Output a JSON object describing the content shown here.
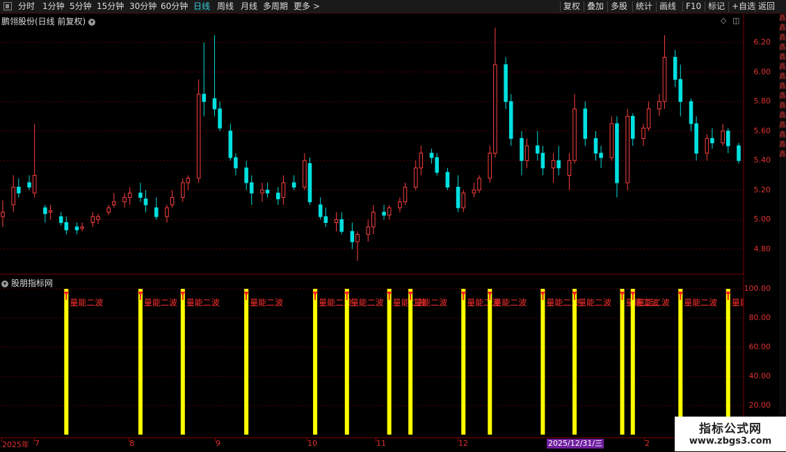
{
  "toolbar": {
    "left_items": [
      "分时",
      "1分钟",
      "5分钟",
      "15分钟",
      "30分钟",
      "60分钟",
      "日线",
      "周线",
      "月线",
      "多周期",
      "更多 >"
    ],
    "active_item": "日线",
    "right_items": [
      "复权",
      "叠加",
      "多股",
      "统计",
      "画线",
      "F10",
      "标记",
      "+自选",
      "返回"
    ]
  },
  "main_chart": {
    "title": "鹏翎股份(日线 前复权)",
    "y_labels": [
      "6.20",
      "6.00",
      "5.80",
      "5.60",
      "5.40",
      "5.20",
      "5.00",
      "4.80"
    ]
  },
  "indicator": {
    "title": "股朋指标网",
    "signal_label": "量能二波",
    "y_labels": [
      "100.00",
      "80.00",
      "60.00",
      "40.00",
      "20.00"
    ]
  },
  "x_axis": {
    "labels": [
      "2025年",
      "7",
      "8",
      "9",
      "10",
      "11",
      "12",
      "2"
    ],
    "cursor_date": "2025/12/31/三"
  },
  "side_strip_text": "鑫鑫鑫鑫鑫鑫鑫鑫鑫鑫鑫鑫鑫鑫鑫",
  "watermark": {
    "title": "指标公式网",
    "url": "www.zbgs3.com"
  },
  "colors": {
    "up": "#ff4040",
    "down": "#00e0e0",
    "signal_bar": "#ffff00",
    "grid": "#5a0000",
    "active": "#39d0e0"
  },
  "chart_data": {
    "type": "candlestick",
    "price_range": [
      4.7,
      6.3
    ],
    "indicator_range": [
      0,
      100
    ],
    "candles": [
      [
        5.02,
        5.13,
        4.95,
        5.05
      ],
      [
        5.1,
        5.3,
        5.05,
        5.22
      ],
      [
        5.22,
        5.28,
        5.15,
        5.18
      ],
      [
        5.25,
        5.3,
        5.2,
        5.22
      ],
      [
        5.18,
        5.65,
        5.15,
        5.3
      ],
      [
        5.08,
        5.1,
        4.98,
        5.04
      ],
      [
        5.05,
        5.1,
        5.0,
        5.06
      ],
      [
        5.02,
        5.05,
        4.96,
        4.98
      ],
      [
        4.98,
        5.02,
        4.9,
        4.93
      ],
      [
        4.95,
        4.98,
        4.9,
        4.93
      ],
      [
        4.94,
        4.98,
        4.92,
        4.95
      ],
      [
        4.98,
        5.05,
        4.95,
        5.02
      ],
      [
        5.0,
        5.04,
        4.97,
        5.02
      ],
      [
        5.05,
        5.1,
        5.03,
        5.08
      ],
      [
        5.1,
        5.18,
        5.08,
        5.12
      ],
      [
        5.12,
        5.18,
        5.08,
        5.15
      ],
      [
        5.15,
        5.22,
        5.1,
        5.18
      ],
      [
        5.18,
        5.25,
        5.12,
        5.15
      ],
      [
        5.14,
        5.2,
        5.05,
        5.1
      ],
      [
        5.08,
        5.15,
        5.0,
        5.02
      ],
      [
        5.02,
        5.1,
        4.98,
        5.08
      ],
      [
        5.1,
        5.2,
        5.08,
        5.15
      ],
      [
        5.15,
        5.28,
        5.12,
        5.25
      ],
      [
        5.25,
        5.3,
        5.2,
        5.28
      ],
      [
        5.28,
        5.95,
        5.25,
        5.85
      ],
      [
        5.85,
        6.2,
        5.7,
        5.8
      ],
      [
        5.82,
        6.25,
        5.7,
        5.75
      ],
      [
        5.75,
        5.8,
        5.6,
        5.62
      ],
      [
        5.6,
        5.65,
        5.4,
        5.42
      ],
      [
        5.42,
        5.45,
        5.3,
        5.35
      ],
      [
        5.35,
        5.4,
        5.2,
        5.25
      ],
      [
        5.25,
        5.3,
        5.1,
        5.18
      ],
      [
        5.18,
        5.25,
        5.12,
        5.2
      ],
      [
        5.2,
        5.25,
        5.15,
        5.18
      ],
      [
        5.18,
        5.22,
        5.1,
        5.14
      ],
      [
        5.15,
        5.3,
        5.1,
        5.25
      ],
      [
        5.25,
        5.3,
        5.2,
        5.22
      ],
      [
        5.22,
        5.45,
        5.2,
        5.4
      ],
      [
        5.38,
        5.42,
        5.1,
        5.12
      ],
      [
        5.1,
        5.15,
        5.0,
        5.02
      ],
      [
        5.02,
        5.08,
        4.95,
        4.98
      ],
      [
        4.98,
        5.05,
        4.92,
        5.0
      ],
      [
        5.0,
        5.05,
        4.9,
        4.92
      ],
      [
        4.92,
        4.98,
        4.8,
        4.85
      ],
      [
        4.85,
        4.92,
        4.72,
        4.9
      ],
      [
        4.9,
        5.0,
        4.85,
        4.95
      ],
      [
        4.95,
        5.1,
        4.9,
        5.05
      ],
      [
        5.05,
        5.1,
        5.0,
        5.03
      ],
      [
        5.03,
        5.1,
        5.0,
        5.08
      ],
      [
        5.08,
        5.15,
        5.05,
        5.12
      ],
      [
        5.12,
        5.25,
        5.1,
        5.22
      ],
      [
        5.22,
        5.4,
        5.2,
        5.35
      ],
      [
        5.35,
        5.5,
        5.3,
        5.45
      ],
      [
        5.45,
        5.48,
        5.38,
        5.42
      ],
      [
        5.42,
        5.45,
        5.3,
        5.32
      ],
      [
        5.32,
        5.35,
        5.2,
        5.22
      ],
      [
        5.22,
        5.3,
        5.05,
        5.08
      ],
      [
        5.08,
        5.2,
        5.05,
        5.18
      ],
      [
        5.18,
        5.25,
        5.15,
        5.2
      ],
      [
        5.2,
        5.3,
        5.18,
        5.28
      ],
      [
        5.28,
        5.5,
        5.25,
        5.45
      ],
      [
        5.45,
        6.3,
        5.42,
        6.05
      ],
      [
        6.05,
        6.1,
        5.75,
        5.8
      ],
      [
        5.8,
        5.85,
        5.5,
        5.55
      ],
      [
        5.55,
        5.6,
        5.3,
        5.4
      ],
      [
        5.4,
        5.55,
        5.35,
        5.5
      ],
      [
        5.5,
        5.6,
        5.4,
        5.45
      ],
      [
        5.45,
        5.5,
        5.3,
        5.35
      ],
      [
        5.35,
        5.45,
        5.25,
        5.4
      ],
      [
        5.4,
        5.5,
        5.3,
        5.35
      ],
      [
        5.3,
        5.45,
        5.2,
        5.4
      ],
      [
        5.4,
        5.85,
        5.38,
        5.75
      ],
      [
        5.75,
        5.8,
        5.5,
        5.55
      ],
      [
        5.55,
        5.6,
        5.4,
        5.45
      ],
      [
        5.45,
        5.5,
        5.35,
        5.42
      ],
      [
        5.42,
        5.7,
        5.4,
        5.65
      ],
      [
        5.65,
        5.7,
        5.15,
        5.25
      ],
      [
        5.25,
        5.75,
        5.2,
        5.7
      ],
      [
        5.7,
        5.72,
        5.5,
        5.55
      ],
      [
        5.55,
        5.65,
        5.5,
        5.62
      ],
      [
        5.62,
        5.8,
        5.6,
        5.75
      ],
      [
        5.75,
        5.85,
        5.7,
        5.8
      ],
      [
        5.8,
        6.25,
        5.75,
        6.1
      ],
      [
        6.1,
        6.15,
        5.9,
        5.95
      ],
      [
        5.95,
        6.05,
        5.7,
        5.8
      ],
      [
        5.8,
        5.82,
        5.6,
        5.65
      ],
      [
        5.65,
        5.7,
        5.4,
        5.45
      ],
      [
        5.45,
        5.58,
        5.4,
        5.55
      ],
      [
        5.55,
        5.62,
        5.48,
        5.52
      ],
      [
        5.52,
        5.65,
        5.5,
        5.6
      ],
      [
        5.6,
        5.62,
        5.45,
        5.5
      ],
      [
        5.5,
        5.52,
        5.38,
        5.4
      ]
    ],
    "signal_bars": [
      {
        "index": 12,
        "value": 100
      },
      {
        "index": 26,
        "value": 100
      },
      {
        "index": 34,
        "value": 100
      },
      {
        "index": 46,
        "value": 100
      },
      {
        "index": 59,
        "value": 100
      },
      {
        "index": 65,
        "value": 100
      },
      {
        "index": 73,
        "value": 100
      },
      {
        "index": 77,
        "value": 100
      },
      {
        "index": 87,
        "value": 100
      },
      {
        "index": 92,
        "value": 100
      },
      {
        "index": 102,
        "value": 100
      },
      {
        "index": 108,
        "value": 100
      },
      {
        "index": 117,
        "value": 100
      },
      {
        "index": 119,
        "value": 100
      },
      {
        "index": 128,
        "value": 100
      },
      {
        "index": 137,
        "value": 100
      }
    ]
  }
}
